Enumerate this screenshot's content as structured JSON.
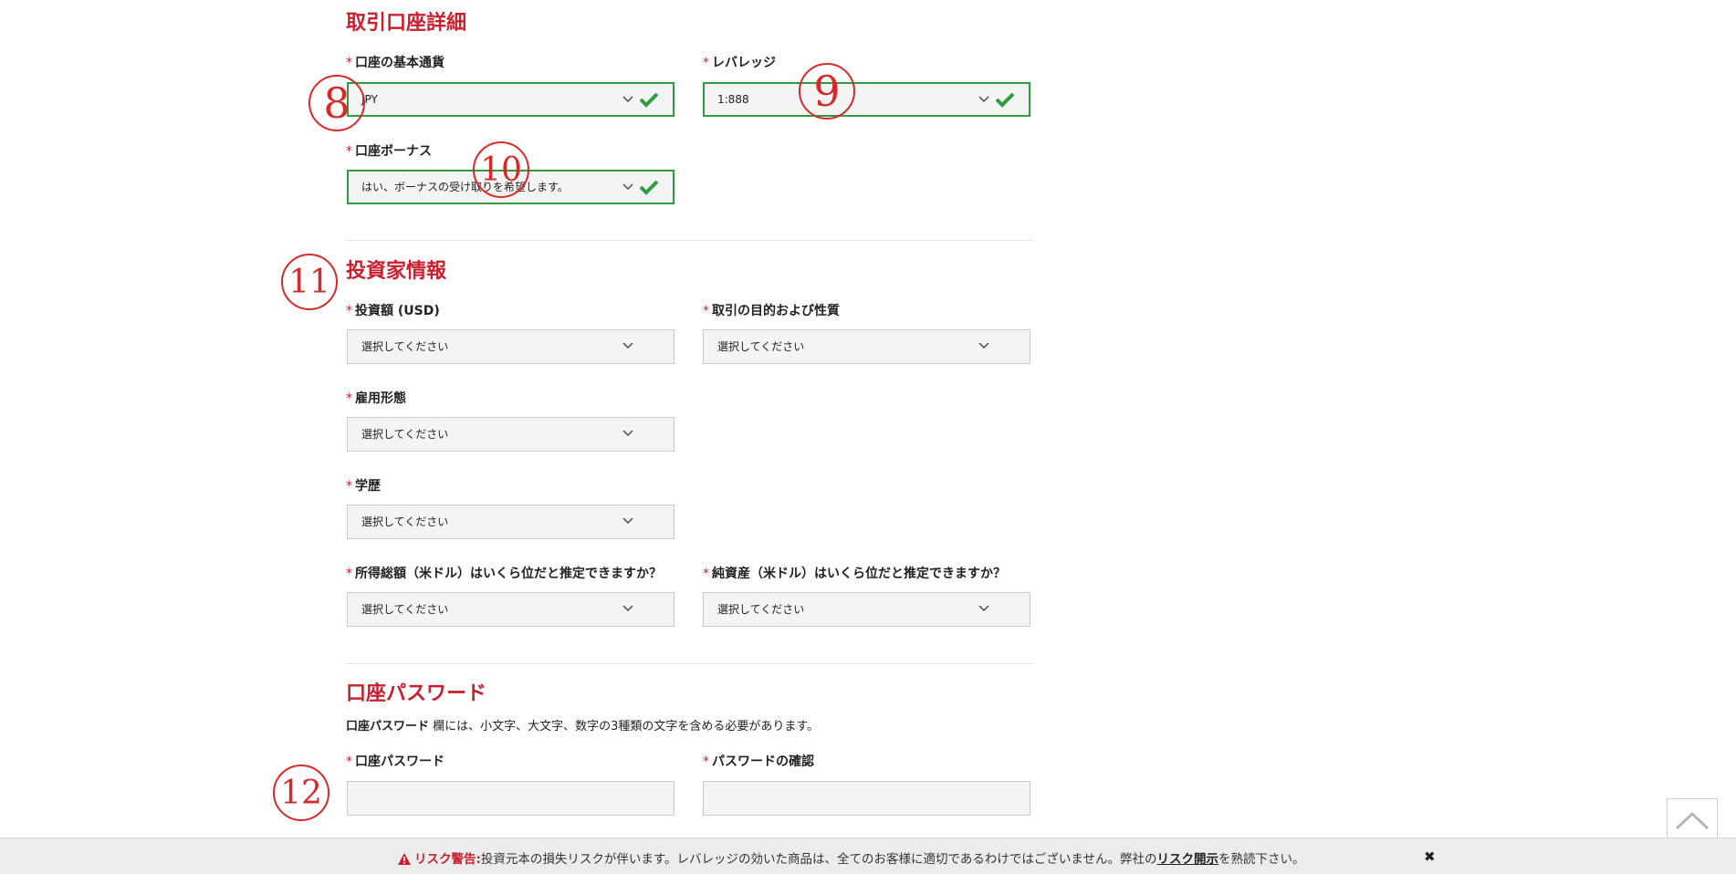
{
  "sections": {
    "account": {
      "title": "取引口座詳細"
    },
    "investor": {
      "title": "投資家情報"
    },
    "password": {
      "title": "口座パスワード",
      "note_bold": "口座パスワード",
      "note_text": " 欄には、小文字、大文字、数字の3種類の文字を含める必要があります。"
    }
  },
  "required_mark": "*",
  "fields": {
    "base_currency": {
      "label": "口座の基本通貨",
      "value": "JPY"
    },
    "leverage": {
      "label": "レバレッジ",
      "value": "1:888"
    },
    "bonus": {
      "label": "口座ボーナス",
      "value": "はい、ボーナスの受け取りを希望します。"
    },
    "investment": {
      "label": "投資額 (USD)",
      "value": "選択してください"
    },
    "purpose": {
      "label": "取引の目的および性質",
      "value": "選択してください"
    },
    "employment": {
      "label": "雇用形態",
      "value": "選択してください"
    },
    "education": {
      "label": "学歴",
      "value": "選択してください"
    },
    "income": {
      "label": "所得総額（米ドル）はいくら位だと推定できますか？",
      "value": "選択してください"
    },
    "net_assets": {
      "label": "純資産（米ドル）はいくら位だと推定できますか？",
      "value": "選択してください"
    },
    "password": {
      "label": "口座パスワード",
      "value": ""
    },
    "password_confirm": {
      "label": "パスワードの確認",
      "value": ""
    }
  },
  "annotations": [
    "8",
    "9",
    "10",
    "11",
    "12"
  ],
  "risk": {
    "warning_label": "リスク警告:",
    "text": "投資元本の損失リスクが伴います。レバレッジの効いた商品は、全てのお客様に適切であるわけではございません。弊社の",
    "link": "リスク開示",
    "suffix": "を熟読下さい。",
    "close": "✖"
  },
  "colors": {
    "accent_red": "#c8202f",
    "valid_green": "#2e9d42",
    "annotation_red": "#d42a2a",
    "field_bg": "#f4f4f4"
  },
  "icons": {
    "dropdown": "chevron-down-icon",
    "valid": "checkmark-icon",
    "scroll_top": "chevron-up-icon",
    "warning": "warning-triangle-icon",
    "close": "close-icon"
  }
}
